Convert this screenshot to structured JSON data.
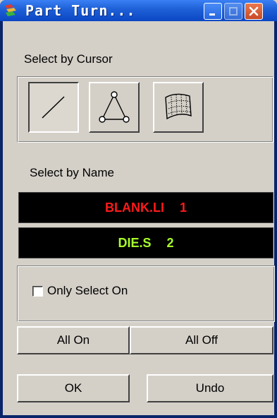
{
  "window": {
    "title": "Part Turn...",
    "icon": "app-parts-icon"
  },
  "cursor_section": {
    "label": "Select by Cursor",
    "tools": [
      {
        "name": "line-select-icon",
        "pressed": true
      },
      {
        "name": "triangle-node-select-icon",
        "pressed": false
      },
      {
        "name": "surface-mesh-select-icon",
        "pressed": false
      }
    ]
  },
  "name_section": {
    "label": "Select by Name",
    "items": [
      {
        "name": "BLANK.LI",
        "id": "1",
        "color": "#ff1a1a"
      },
      {
        "name": "DIE.S",
        "id": "2",
        "color": "#a8ff2a"
      }
    ]
  },
  "options": {
    "only_select_on_label": "Only Select On",
    "only_select_on_checked": false
  },
  "buttons": {
    "all_on": "All On",
    "all_off": "All Off",
    "ok": "OK",
    "undo": "Undo"
  }
}
